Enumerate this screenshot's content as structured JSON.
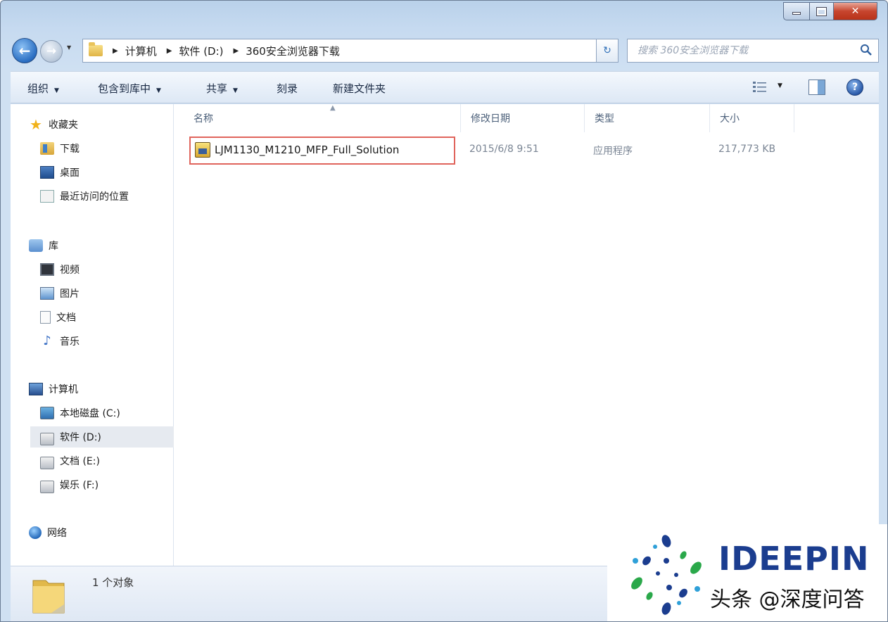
{
  "address": {
    "breadcrumbs": [
      "计算机",
      "软件 (D:)",
      "360安全浏览器下载"
    ]
  },
  "search": {
    "placeholder": "搜索 360安全浏览器下载"
  },
  "toolbar": {
    "organize": "组织",
    "include_in_library": "包含到库中",
    "share": "共享",
    "burn": "刻录",
    "new_folder": "新建文件夹"
  },
  "sidebar": {
    "favorites": "收藏夹",
    "downloads": "下载",
    "desktop": "桌面",
    "recent_places": "最近访问的位置",
    "libraries": "库",
    "videos": "视频",
    "pictures": "图片",
    "documents": "文档",
    "music": "音乐",
    "computer": "计算机",
    "drive_c": "本地磁盘 (C:)",
    "drive_d": "软件 (D:)",
    "drive_e": "文档 (E:)",
    "drive_f": "娱乐 (F:)",
    "network": "网络"
  },
  "columns": {
    "name": "名称",
    "modified": "修改日期",
    "type": "类型",
    "size": "大小"
  },
  "files": [
    {
      "name": "LJM1130_M1210_MFP_Full_Solution",
      "modified": "2015/6/8 9:51",
      "type": "应用程序",
      "size": "217,773 KB"
    }
  ],
  "status": {
    "count": "1 个对象"
  },
  "watermark": {
    "brand": "IDEEPIN",
    "caption": "头条 @深度问答"
  },
  "colors": {
    "highlight_border": "#e0645c",
    "brand_blue": "#1b3d8f",
    "title_gradient_top": "#b9d1ea"
  }
}
